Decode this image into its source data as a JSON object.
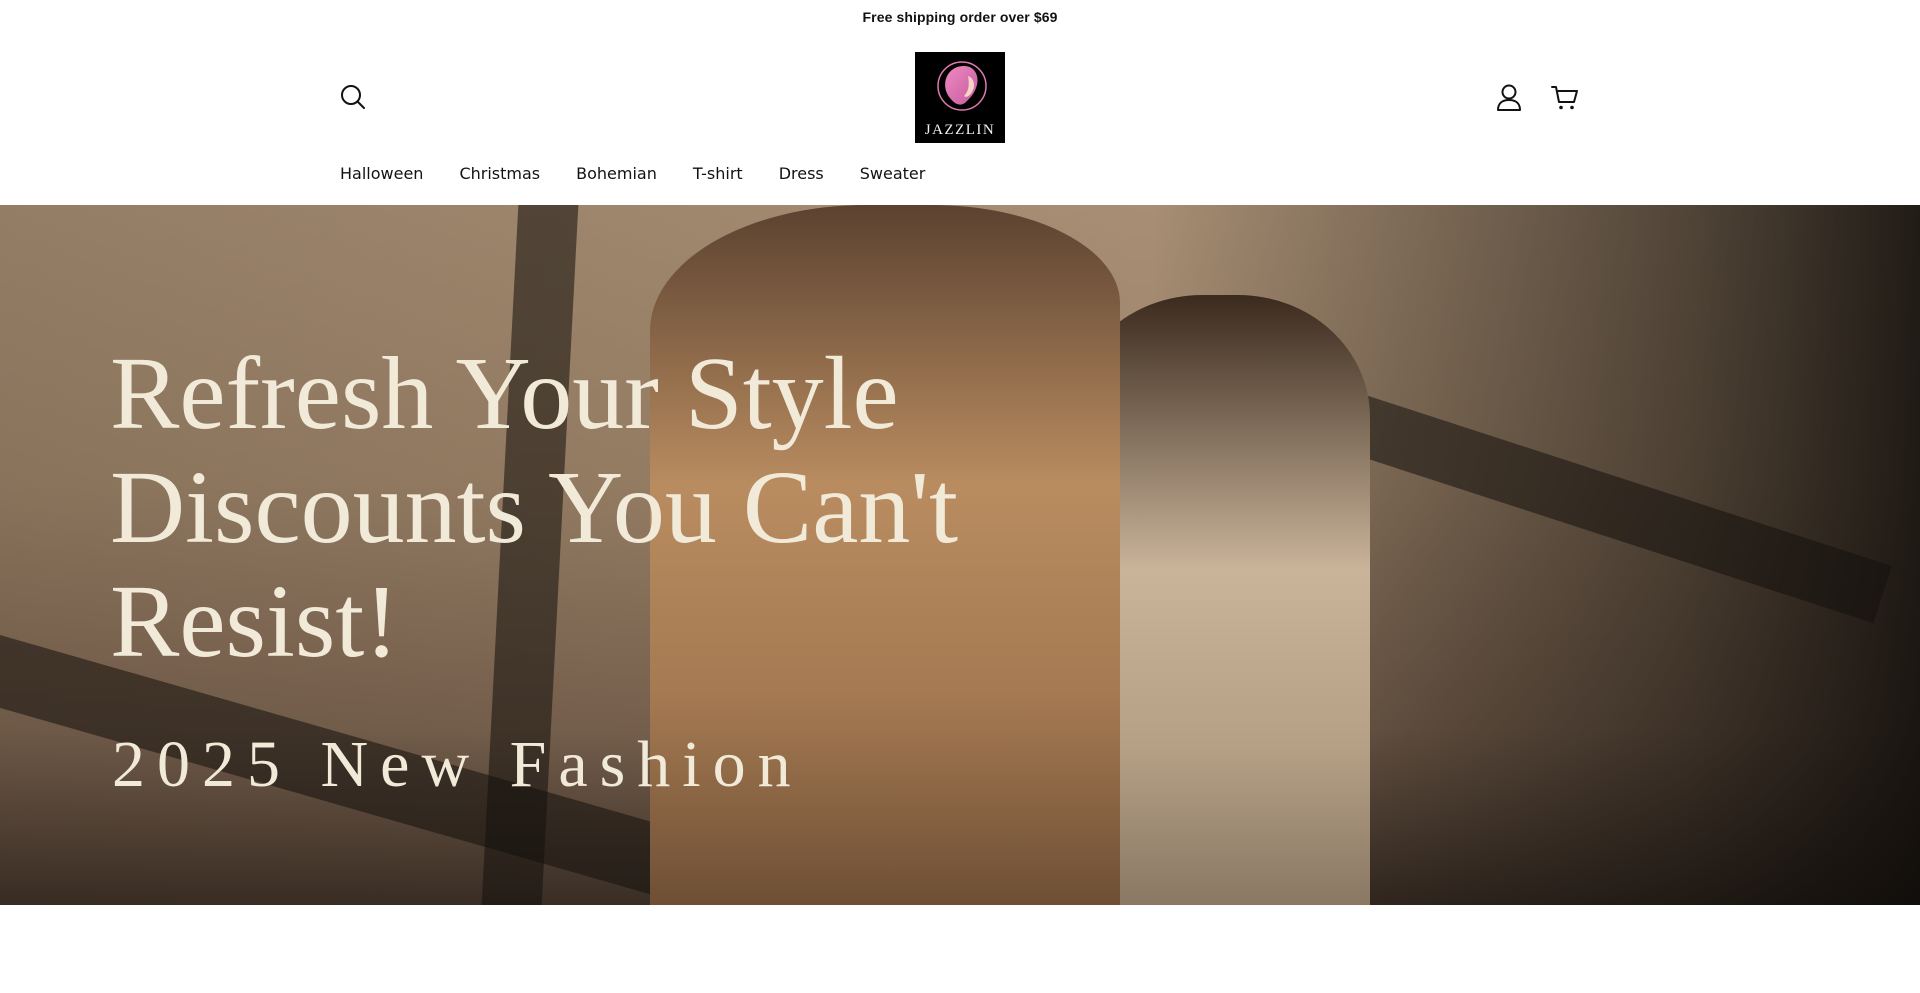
{
  "announcement": {
    "text": "Free shipping order over $69"
  },
  "header": {
    "logo_text": "JAZZLIN",
    "icons": {
      "search": "search-icon",
      "account": "account-icon",
      "cart": "cart-icon"
    }
  },
  "nav": {
    "items": [
      {
        "label": "Halloween"
      },
      {
        "label": "Christmas"
      },
      {
        "label": "Bohemian"
      },
      {
        "label": "T-shirt"
      },
      {
        "label": "Dress"
      },
      {
        "label": "Sweater"
      }
    ]
  },
  "hero": {
    "title_line_1": "Refresh Your Style",
    "title_line_2": "Discounts You Can't",
    "title_line_3": "Resist!",
    "subtitle": "2025 New Fashion"
  },
  "colors": {
    "hero_text": "#f1ead8",
    "logo_bg": "#000000",
    "logo_accent": "#e07ab0"
  }
}
